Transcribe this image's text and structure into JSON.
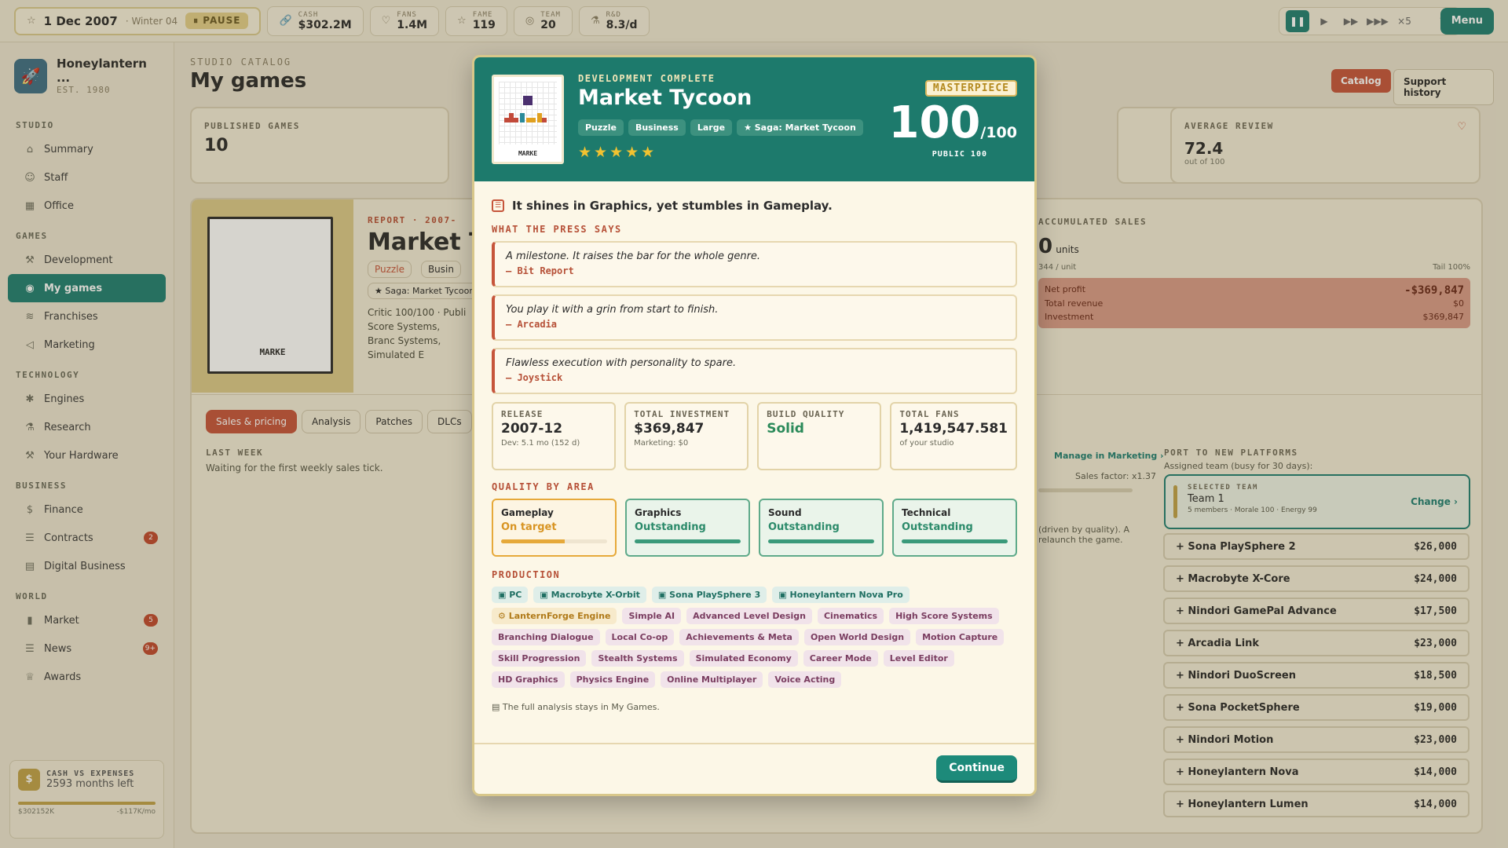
{
  "topbar": {
    "date": "1 Dec 2007",
    "season": "· Winter 04",
    "pause_label": "PAUSE",
    "stats": [
      {
        "icon": "link-icon",
        "glyph": "🔗",
        "label": "CASH",
        "value": "$302.2M"
      },
      {
        "icon": "heart-icon",
        "glyph": "♡",
        "label": "FANS",
        "value": "1.4M"
      },
      {
        "icon": "star-icon",
        "glyph": "☆",
        "label": "FAME",
        "value": "119"
      },
      {
        "icon": "team-icon",
        "glyph": "◎",
        "label": "TEAM",
        "value": "20"
      },
      {
        "icon": "flask-icon",
        "glyph": "⚗",
        "label": "R&D",
        "value": "8.3/d"
      }
    ],
    "speed_multiplier": "×5",
    "help_label": "?",
    "menu_label": "Menu"
  },
  "sidebar": {
    "studio_name": "Honeylantern ...",
    "studio_est": "EST. 1980",
    "groups": [
      {
        "label": "STUDIO",
        "items": [
          {
            "label": "Summary",
            "glyph": "⌂",
            "icon": "home-icon"
          },
          {
            "label": "Staff",
            "glyph": "☺",
            "icon": "staff-icon"
          },
          {
            "label": "Office",
            "glyph": "▦",
            "icon": "office-icon"
          }
        ]
      },
      {
        "label": "GAMES",
        "items": [
          {
            "label": "Development",
            "glyph": "⚒",
            "icon": "hammer-icon"
          },
          {
            "label": "My games",
            "glyph": "◉",
            "icon": "games-icon",
            "active": true
          },
          {
            "label": "Franchises",
            "glyph": "≋",
            "icon": "franchise-icon"
          },
          {
            "label": "Marketing",
            "glyph": "◁",
            "icon": "megaphone-icon"
          }
        ]
      },
      {
        "label": "TECHNOLOGY",
        "items": [
          {
            "label": "Engines",
            "glyph": "✱",
            "icon": "engine-icon"
          },
          {
            "label": "Research",
            "glyph": "⚗",
            "icon": "flask-icon"
          },
          {
            "label": "Your Hardware",
            "glyph": "⚒",
            "icon": "hardware-icon"
          }
        ]
      },
      {
        "label": "BUSINESS",
        "items": [
          {
            "label": "Finance",
            "glyph": "$",
            "icon": "finance-icon"
          },
          {
            "label": "Contracts",
            "glyph": "☰",
            "icon": "contract-icon",
            "badge": "2"
          },
          {
            "label": "Digital Business",
            "glyph": "▤",
            "icon": "store-icon"
          }
        ]
      },
      {
        "label": "WORLD",
        "items": [
          {
            "label": "Market",
            "glyph": "▮",
            "icon": "chart-icon",
            "badge": "5"
          },
          {
            "label": "News",
            "glyph": "☰",
            "icon": "news-icon",
            "badge": "9+"
          },
          {
            "label": "Awards",
            "glyph": "♕",
            "icon": "trophy-icon"
          }
        ]
      }
    ],
    "cash_card": {
      "title": "CASH VS EXPENSES",
      "months": "2593 months left",
      "left": "$302152K",
      "right": "-$117K/mo"
    }
  },
  "main": {
    "catalog_label": "STUDIO CATALOG",
    "title": "My games",
    "catalog_btn": "Catalog",
    "support_btn": "Support history",
    "published_label": "PUBLISHED GAMES",
    "published_value": "10",
    "avg_label": "AVERAGE REVIEW",
    "avg_value": "72.4",
    "avg_sub": "out of 100",
    "report_label": "REPORT · 2007-",
    "report_title": "Market T",
    "report_tags": [
      "Puzzle",
      "Busin"
    ],
    "report_saga": "★ Saga: Market Tycoon",
    "report_text": "Critic 100/100 · Publi Score Systems, Branc Systems, Simulated E",
    "cover_text": "MARKE",
    "tabs": [
      "Sales & pricing",
      "Analysis",
      "Patches",
      "DLCs"
    ],
    "last_week_label": "LAST WEEK",
    "last_week_text": "Waiting for the first weekly sales tick.",
    "accum_label": "ACCUMULATED SALES",
    "accum_value": "0",
    "accum_units": "units",
    "per_unit": "344 / unit",
    "tail": "Tail 100%",
    "net_profit_label": "Net profit",
    "net_profit_value": "-$369,847",
    "revenue_label": "Total revenue",
    "revenue_value": "$0",
    "investment_label": "Investment",
    "investment_value": "$369,847",
    "manage_link": "Manage in Marketing ›",
    "sales_factor": "Sales factor: x1.37",
    "quality_note": "(driven by quality). A relaunch the game.",
    "port_label": "PORT TO NEW PLATFORMS",
    "port_sub": "Assigned team (busy for 30 days):",
    "selected_team_label": "SELECTED TEAM",
    "selected_team": "Team 1",
    "selected_team_meta": "5 members · Morale 100 · Energy 99",
    "change_label": "Change ›",
    "ports": [
      {
        "name": "+ Sona PlaySphere 2",
        "price": "$26,000"
      },
      {
        "name": "+ Macrobyte X-Core",
        "price": "$24,000"
      },
      {
        "name": "+ Nindori GamePal Advance",
        "price": "$17,500"
      },
      {
        "name": "+ Arcadia Link",
        "price": "$23,000"
      },
      {
        "name": "+ Nindori DuoScreen",
        "price": "$18,500"
      },
      {
        "name": "+ Sona PocketSphere",
        "price": "$19,000"
      },
      {
        "name": "+ Nindori Motion",
        "price": "$23,000"
      },
      {
        "name": "+ Honeylantern Nova",
        "price": "$14,000"
      },
      {
        "name": "+ Honeylantern Lumen",
        "price": "$14,000"
      }
    ]
  },
  "modal": {
    "eyebrow": "DEVELOPMENT COMPLETE",
    "title": "Market Tycoon",
    "cover_text": "MARKE",
    "tags": [
      "Puzzle",
      "Business",
      "Large",
      "★ Saga: Market Tycoon"
    ],
    "stars": "★★★★★",
    "badge": "MASTERPIECE",
    "score": "100",
    "score_max": "/100",
    "public": "PUBLIC 100",
    "verdict": "It shines in Graphics, yet stumbles in Gameplay.",
    "press_label": "WHAT THE PRESS SAYS",
    "quotes": [
      {
        "text": "A milestone. It raises the bar for the whole genre.",
        "source": "— Bit Report"
      },
      {
        "text": "You play it with a grin from start to finish.",
        "source": "— Arcadia"
      },
      {
        "text": "Flawless execution with personality to spare.",
        "source": "— Joystick"
      }
    ],
    "kpis": [
      {
        "label": "RELEASE",
        "value": "2007-12",
        "sub": "Dev: 5.1 mo (152 d)"
      },
      {
        "label": "TOTAL INVESTMENT",
        "value": "$369,847",
        "sub": "Marketing: $0"
      },
      {
        "label": "BUILD QUALITY",
        "value": "Solid",
        "sub": ""
      },
      {
        "label": "TOTAL FANS",
        "value": "1,419,547.581",
        "sub": "of your studio"
      }
    ],
    "quality_label": "QUALITY BY AREA",
    "quality": [
      {
        "name": "Gameplay",
        "status": "On target",
        "level": 0.6,
        "warn": true
      },
      {
        "name": "Graphics",
        "status": "Outstanding",
        "level": 1.0
      },
      {
        "name": "Sound",
        "status": "Outstanding",
        "level": 1.0
      },
      {
        "name": "Technical",
        "status": "Outstanding",
        "level": 1.0
      }
    ],
    "production_label": "PRODUCTION",
    "platforms": [
      "PC",
      "Macrobyte X-Orbit",
      "Sona PlaySphere 3",
      "Honeylantern Nova Pro"
    ],
    "engine": "LanternForge Engine",
    "features": [
      "Simple AI",
      "Advanced Level Design",
      "Cinematics",
      "High Score Systems",
      "Branching Dialogue",
      "Local Co-op",
      "Achievements & Meta",
      "Open World Design",
      "Motion Capture",
      "Skill Progression",
      "Stealth Systems",
      "Simulated Economy",
      "Career Mode",
      "Level Editor",
      "HD Graphics",
      "Physics Engine",
      "Online Multiplayer",
      "Voice Acting"
    ],
    "note": "The full analysis stays in My Games.",
    "continue_label": "Continue"
  }
}
